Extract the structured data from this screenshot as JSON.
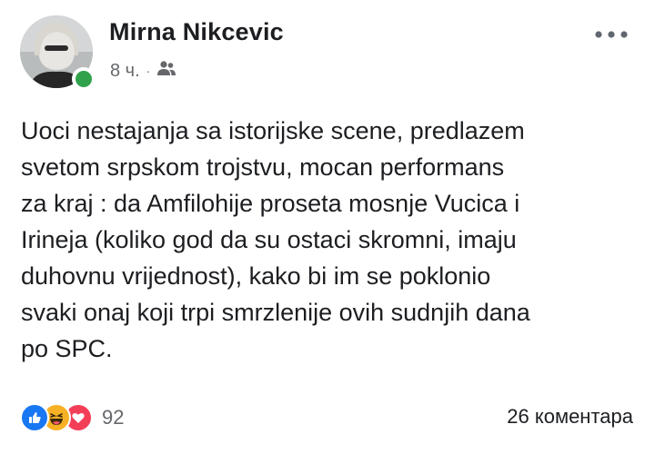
{
  "post": {
    "author_name": "Mirna Nikcevic",
    "timestamp": "8 ч.",
    "separator": "·",
    "audience_icon": "friends-icon",
    "more_icon": "more-dots-icon",
    "text": "Uoci nestajanja sa istorijske scene, predlazem\nsvetom srpskom trojstvu, mocan performans\nza kraj : da Amfilohije proseta mosnje Vucica i\nIrineja (koliko god da su ostaci skromni, imaju\nduhovnu vrijednost), kako bi im se poklonio\nsvaki onaj koji trpi smrzlenije ovih sudnjih dana\npo SPC."
  },
  "reactions": {
    "icons": [
      "like-icon",
      "haha-icon",
      "love-icon"
    ],
    "count": "92"
  },
  "comments": {
    "label": "26 коментара"
  },
  "colors": {
    "online": "#31a24c",
    "like": "#1877f2",
    "haha": "#f7b125",
    "love": "#f33e58",
    "secondary_text": "#65676b"
  }
}
